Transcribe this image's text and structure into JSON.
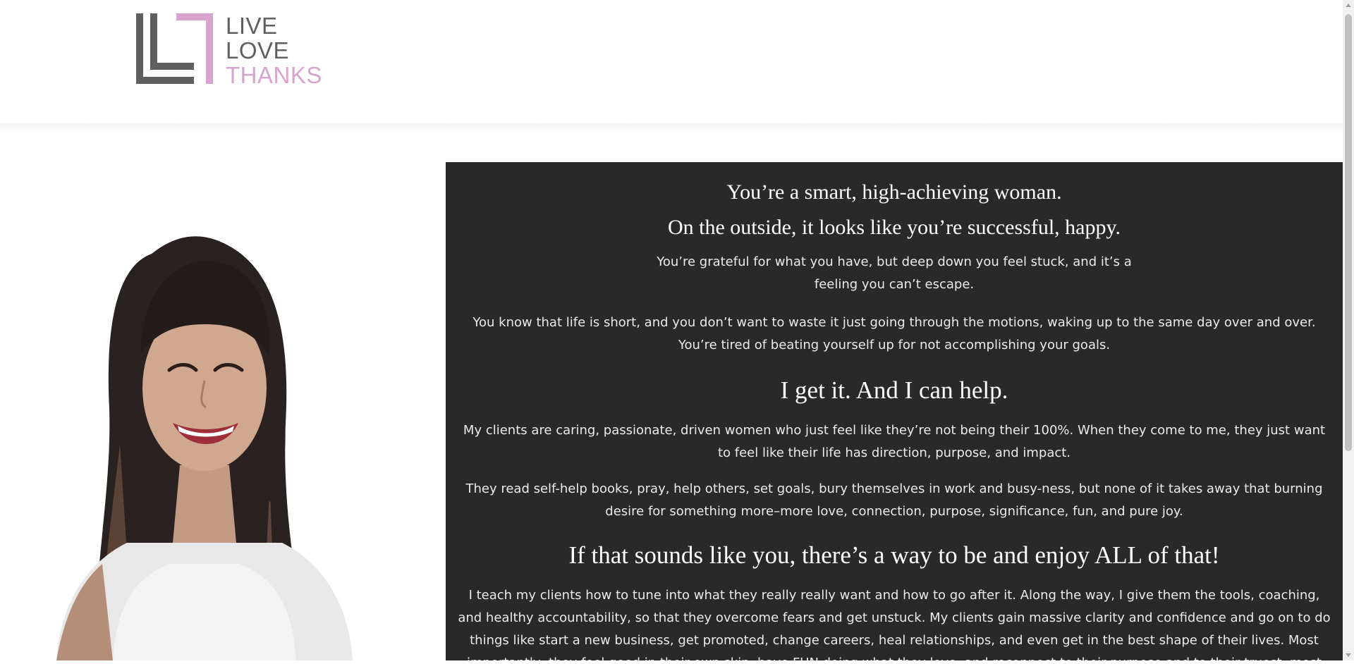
{
  "brand": {
    "logo_lines": [
      "LIVE",
      "LOVE",
      "THANKS"
    ],
    "colors": {
      "gray": "#5f5f5f",
      "pink": "#d8a3cf",
      "panel": "#292929"
    }
  },
  "hero": {
    "photo_alt": "smiling woman with long dark hair and bangs"
  },
  "content": {
    "heading_1": "You’re a smart, high-achieving woman.",
    "heading_2": "On the outside, it looks like you’re successful, happy.",
    "para_1": "You’re grateful for what you have, but deep down you feel stuck, and it’s a feeling you can’t escape.",
    "para_2": "You know that life is short, and you don’t want to waste it just going through the motions, waking up to the same day over and over. You’re tired of beating yourself up for not accomplishing your goals.",
    "heading_3": "I get it. And I can help.",
    "para_3": "My clients are caring, passionate, driven women who just feel like they’re not being their 100%. When they come to me, they just want to feel like their life has direction, purpose, and impact.",
    "para_4": "They read self-help books, pray, help others, set goals, bury themselves in work and busy-ness, but none of it takes away that burning desire for something more–more love, connection, purpose, significance, fun, and pure joy.",
    "heading_4": "If that sounds like you, there’s a way to be and enjoy ALL of that!",
    "para_5": "I teach my clients how to tune into what they really really want and how to go after it. Along the way, I give them the tools, coaching, and healthy accountability, so that they overcome fears and get unstuck. My clients gain massive clarity and confidence and go on to do things like start a new business, get promoted, change careers, heal relationships, and even get in the best shape of their lives. Most importantly, they feel good in their own skin, have FUN doing what they love, and reconnect to their purpose and to their truest, most joyful self."
  }
}
